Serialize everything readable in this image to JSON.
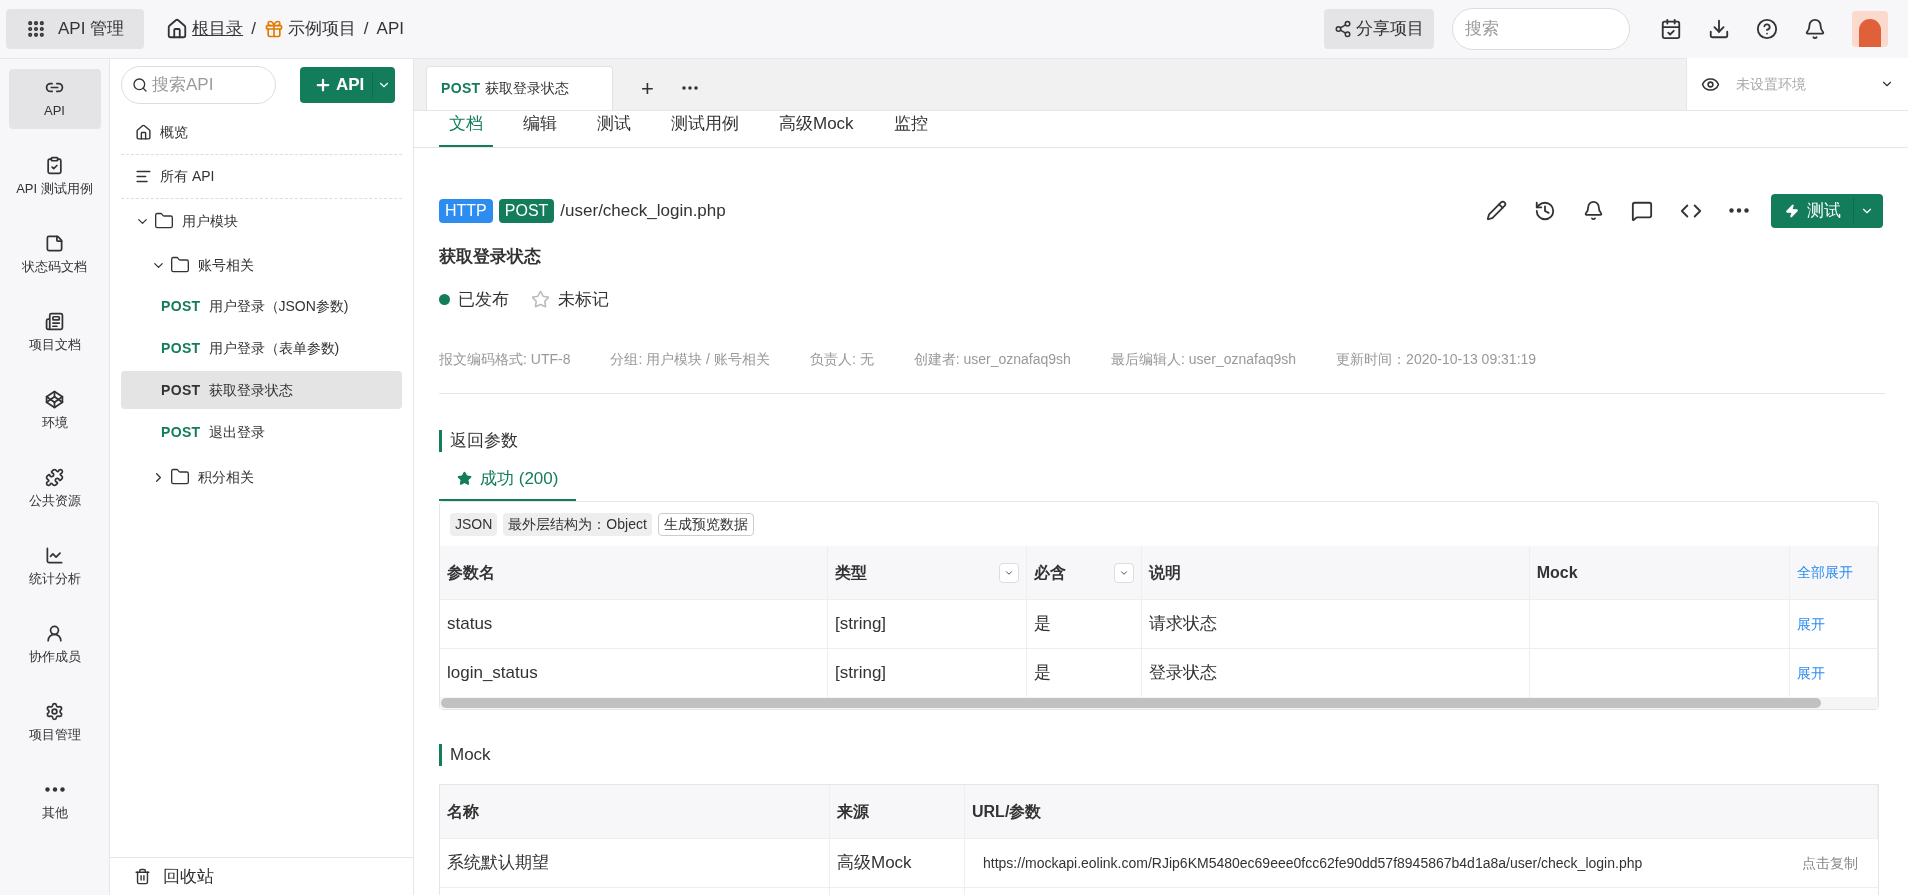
{
  "top_bar": {
    "app_button": "API 管理",
    "breadcrumb": [
      {
        "label": "根目录",
        "kind": "home"
      },
      {
        "separator": "/",
        "label": "示例项目",
        "kind": "gift"
      },
      {
        "separator": "/",
        "label": "API",
        "kind": "plain"
      }
    ],
    "share_button": "分享项目",
    "search": {
      "placeholder": "搜索"
    }
  },
  "rail": [
    {
      "label": "API",
      "selected": true
    },
    {
      "label": "API 测试用例",
      "selected": false
    },
    {
      "label": "状态码文档",
      "selected": false
    },
    {
      "label": "项目文档",
      "selected": false
    },
    {
      "label": "环境",
      "selected": false
    },
    {
      "label": "公共资源",
      "selected": false
    },
    {
      "label": "统计分析",
      "selected": false
    },
    {
      "label": "协作成员",
      "selected": false
    },
    {
      "label": "项目管理",
      "selected": false
    },
    {
      "label": "其他",
      "selected": false
    }
  ],
  "tree": {
    "search": {
      "placeholder": "搜索API"
    },
    "add_button": "API",
    "top_items": [
      {
        "label": "概览"
      },
      {
        "label": "所有 API"
      }
    ],
    "items": [
      {
        "kind": "folder",
        "label": "用户模块",
        "expanded": true,
        "children": [
          {
            "kind": "folder",
            "label": "账号相关",
            "expanded": true,
            "children": [
              {
                "kind": "api",
                "method": "POST",
                "label": "用户登录（JSON参数)",
                "selected": false
              },
              {
                "kind": "api",
                "method": "POST",
                "label": "用户登录（表单参数)",
                "selected": false
              },
              {
                "kind": "api",
                "method": "POST",
                "label": "获取登录状态",
                "selected": true
              },
              {
                "kind": "api",
                "method": "POST",
                "label": "退出登录",
                "selected": false
              }
            ]
          },
          {
            "kind": "folder",
            "label": "积分相关",
            "expanded": false
          }
        ]
      }
    ],
    "trash": "回收站"
  },
  "doc_tabs": [
    {
      "method": "POST",
      "label": "获取登录状态",
      "selected": true
    }
  ],
  "tab_add": "+",
  "env": {
    "placeholder": "未设置环境"
  },
  "sub_tabs": [
    {
      "label": "文档",
      "selected": true
    },
    {
      "label": "编辑",
      "selected": false
    },
    {
      "label": "测试",
      "selected": false
    },
    {
      "label": "测试用例",
      "selected": false
    },
    {
      "label": "高级Mock",
      "selected": false
    },
    {
      "label": "监控",
      "selected": false
    }
  ],
  "api": {
    "protocol": "HTTP",
    "method": "POST",
    "path": "/user/check_login.php",
    "title": "获取登录状态",
    "status": "已发布",
    "star": {
      "label": "未标记",
      "starred": false
    },
    "test_button": "测试",
    "meta": [
      "报文编码格式: UTF-8",
      "分组: 用户模块 / 账号相关",
      "负责人: 无",
      "创建者: user_oznafaq9sh",
      "最后编辑人: user_oznafaq9sh",
      "更新时间：2020-10-13 09:31:19"
    ]
  },
  "response": {
    "heading": "返回参数",
    "tabs": [
      {
        "label": "成功 (200)",
        "selected": true
      }
    ],
    "tags": [
      "JSON",
      "最外层结构为：Object"
    ],
    "preview_button": "生成预览数据",
    "columns": [
      "参数名",
      "类型",
      "必含",
      "说明",
      "Mock",
      "全部展开"
    ],
    "rows": [
      [
        "status",
        "[string]",
        "是",
        "请求状态",
        "",
        "展开"
      ],
      [
        "login_status",
        "[string]",
        "是",
        "登录状态",
        "",
        "展开"
      ]
    ]
  },
  "mock": {
    "heading": "Mock",
    "columns": [
      "名称",
      "来源",
      "URL/参数"
    ],
    "rows": [
      [
        "系统默认期望",
        "高级Mock",
        "https://mockapi.eolink.com/RJip6KM5480ec69eee0fcc62fe90dd57f8945867b4d1a8a/user/check_login.php",
        "点击复制"
      ]
    ]
  }
}
